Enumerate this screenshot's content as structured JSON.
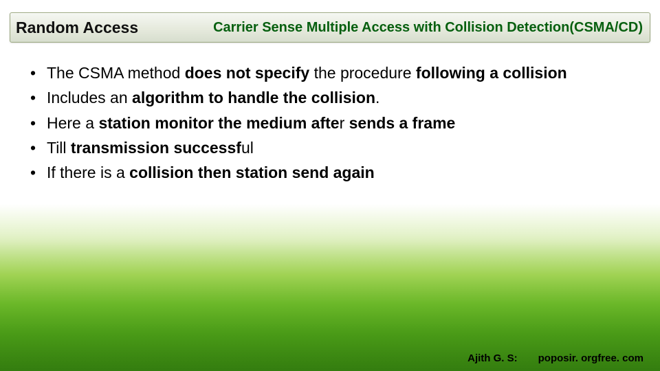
{
  "title_bar": {
    "left": "Random Access",
    "right": "Carrier Sense Multiple Access  with Collision Detection(CSMA/CD)"
  },
  "bullets": [
    {
      "runs": [
        {
          "t": "The CSMA method ",
          "b": false
        },
        {
          "t": "does not specify",
          "b": true
        },
        {
          "t": " the procedure ",
          "b": false
        },
        {
          "t": "following a collision",
          "b": true
        }
      ]
    },
    {
      "runs": [
        {
          "t": " Includes an ",
          "b": false
        },
        {
          "t": "algorithm to handle the collision",
          "b": true
        },
        {
          "t": ".",
          "b": false
        }
      ]
    },
    {
      "runs": [
        {
          "t": "Here a ",
          "b": false
        },
        {
          "t": "station monitor the medium afte",
          "b": true
        },
        {
          "t": "r ",
          "b": false
        },
        {
          "t": "sends a frame",
          "b": true
        }
      ]
    },
    {
      "runs": [
        {
          "t": "Till ",
          "b": false
        },
        {
          "t": "transmission successf",
          "b": true
        },
        {
          "t": "ul",
          "b": false
        }
      ]
    },
    {
      "runs": [
        {
          "t": "If there is a ",
          "b": false
        },
        {
          "t": "collision then station send again",
          "b": true
        }
      ]
    }
  ],
  "footer": {
    "author": "Ajith G. S:",
    "site": "poposir. orgfree. com"
  }
}
